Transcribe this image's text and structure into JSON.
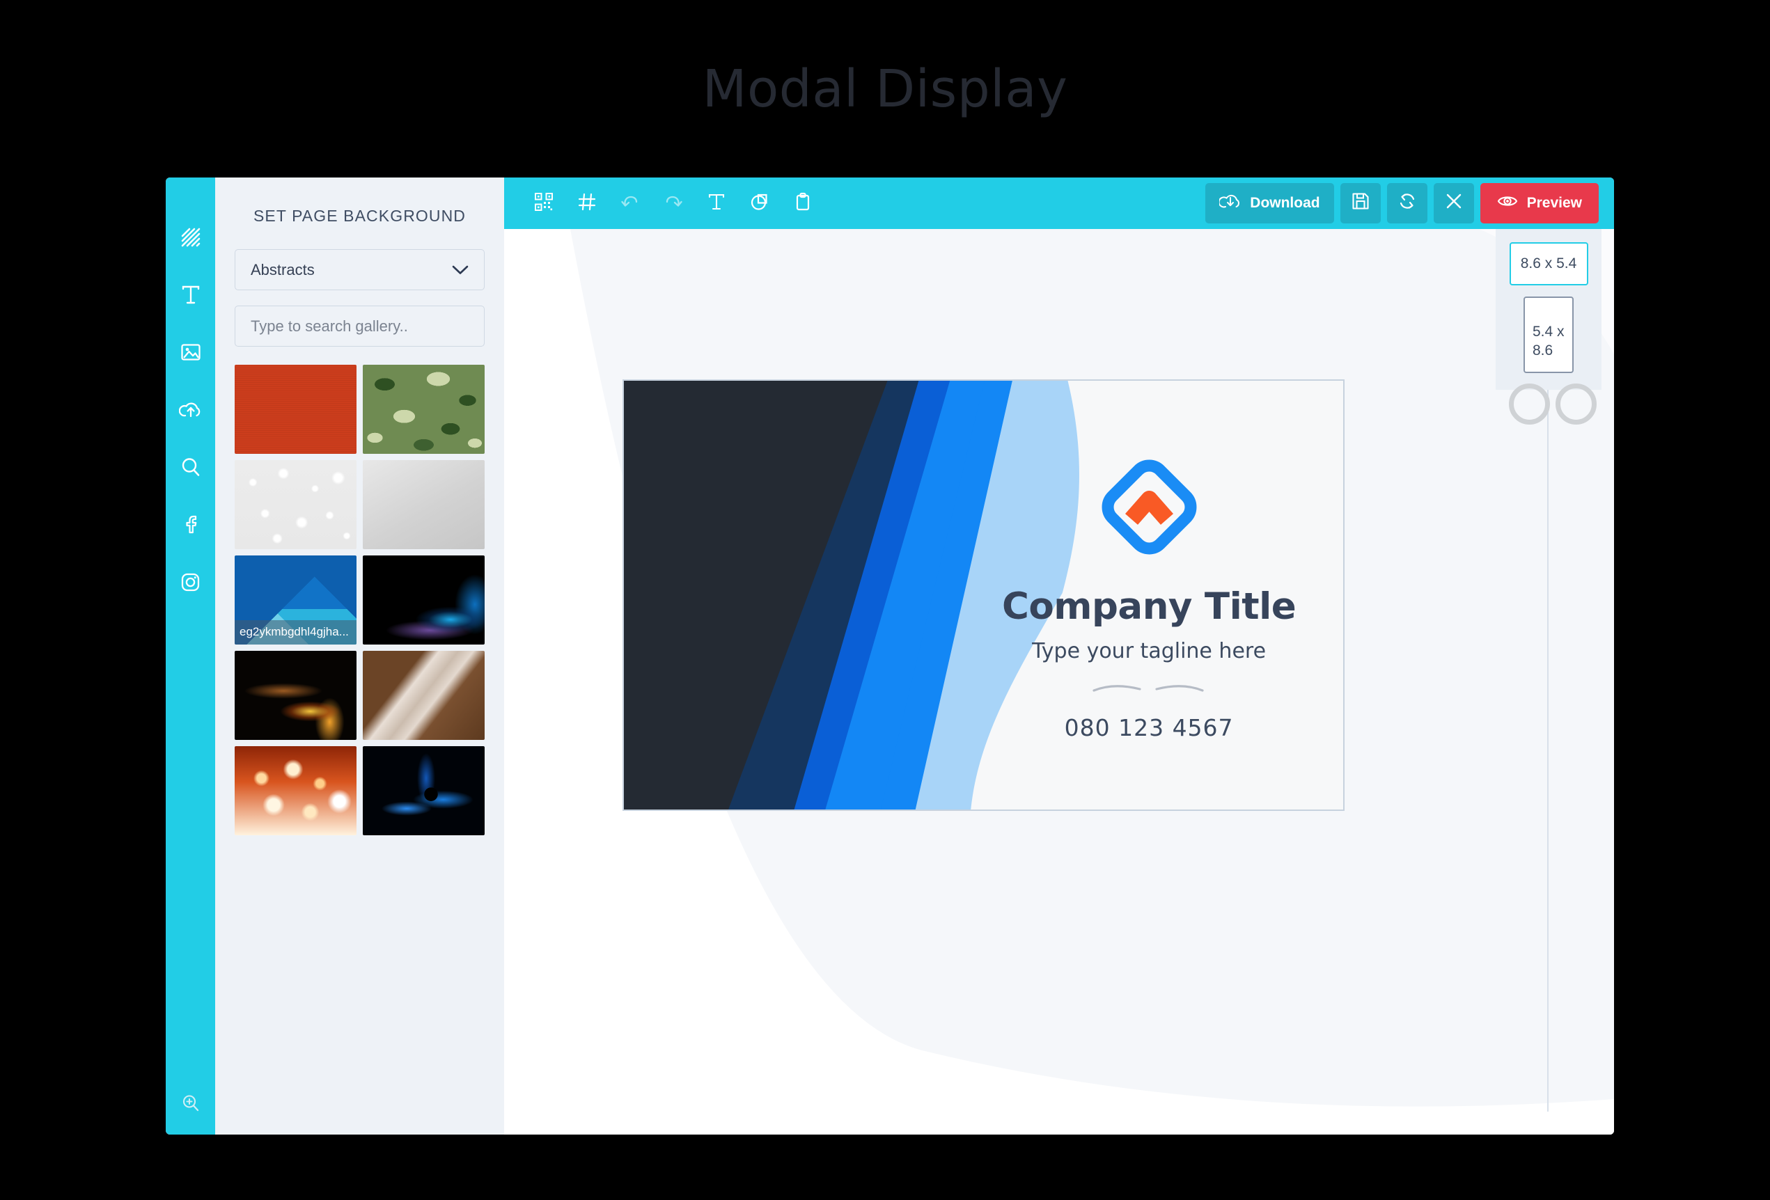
{
  "page": {
    "title": "Modal Display"
  },
  "colors": {
    "accent_cyan": "#22cde6",
    "toolbar_button": "#1fafc6",
    "preview_red": "#e8394b",
    "panel_bg": "#eef2f7",
    "canvas_bg": "#f6f8fa",
    "text_dark": "#37445b",
    "logo_blue": "#1a8cf5",
    "logo_orange": "#f95a25"
  },
  "rail": {
    "items": [
      {
        "icon": "pattern-background-icon",
        "name": "backgrounds"
      },
      {
        "icon": "text-icon",
        "name": "text"
      },
      {
        "icon": "image-icon",
        "name": "images"
      },
      {
        "icon": "upload-cloud-icon",
        "name": "uploads"
      },
      {
        "icon": "search-icon",
        "name": "search"
      },
      {
        "icon": "facebook-icon",
        "name": "facebook"
      },
      {
        "icon": "instagram-icon",
        "name": "instagram"
      }
    ],
    "zoom_icon": "zoom-in-icon"
  },
  "left_panel": {
    "heading": "SET PAGE BACKGROUND",
    "category": {
      "selected": "Abstracts",
      "chevron": "chevron-down-icon"
    },
    "search": {
      "value": "",
      "placeholder": "Type to search gallery.."
    },
    "thumbnails": [
      {
        "id": 1,
        "texture": "t-solid-red",
        "label": ""
      },
      {
        "id": 2,
        "texture": "t-camo",
        "label": ""
      },
      {
        "id": 3,
        "texture": "t-bokeh-white",
        "label": ""
      },
      {
        "id": 4,
        "texture": "t-gray-grad",
        "label": ""
      },
      {
        "id": 5,
        "texture": "t-blue-cubes",
        "label": "eg2ykmbgdhl4gjha..."
      },
      {
        "id": 6,
        "texture": "t-blue-swirl",
        "label": ""
      },
      {
        "id": 7,
        "texture": "t-fire",
        "label": ""
      },
      {
        "id": 8,
        "texture": "t-brown-streak",
        "label": ""
      },
      {
        "id": 9,
        "texture": "t-bokeh-orange",
        "label": ""
      },
      {
        "id": 10,
        "texture": "t-blue-burst",
        "label": ""
      }
    ]
  },
  "toolbar": {
    "left_icons": [
      {
        "icon": "qr-code-icon",
        "name": "qr-code",
        "enabled": true
      },
      {
        "icon": "grid-icon",
        "name": "grid",
        "enabled": true
      },
      {
        "icon": "undo-icon",
        "name": "undo",
        "enabled": false
      },
      {
        "icon": "redo-icon",
        "name": "redo",
        "enabled": false
      },
      {
        "icon": "text-tool-icon",
        "name": "add-text",
        "enabled": true
      },
      {
        "icon": "shape-icon",
        "name": "add-shape",
        "enabled": true
      },
      {
        "icon": "clipboard-icon",
        "name": "clipboard",
        "enabled": true
      }
    ],
    "download_label": "Download",
    "download_icon": "download-cloud-icon",
    "save_icon": "save-floppy-icon",
    "reset_icon": "refresh-icon",
    "close_icon": "close-x-icon",
    "preview_label": "Preview",
    "preview_icon": "eye-icon"
  },
  "size_panel": {
    "landscape_label": "8.6 x 5.4",
    "portrait_label": "5.4 x 8.6",
    "selected": "8.6 x 5.4"
  },
  "card": {
    "title": "Company Title",
    "tagline": "Type your tagline here",
    "phone": "080 123 4567",
    "logo_name": "diamond-chevron-logo",
    "divider_name": "wave-divider",
    "wave_colors": [
      "#242a33",
      "#15365f",
      "#0a5fd6",
      "#1387f5",
      "#a8d4f8",
      "#f7f8f9"
    ]
  }
}
